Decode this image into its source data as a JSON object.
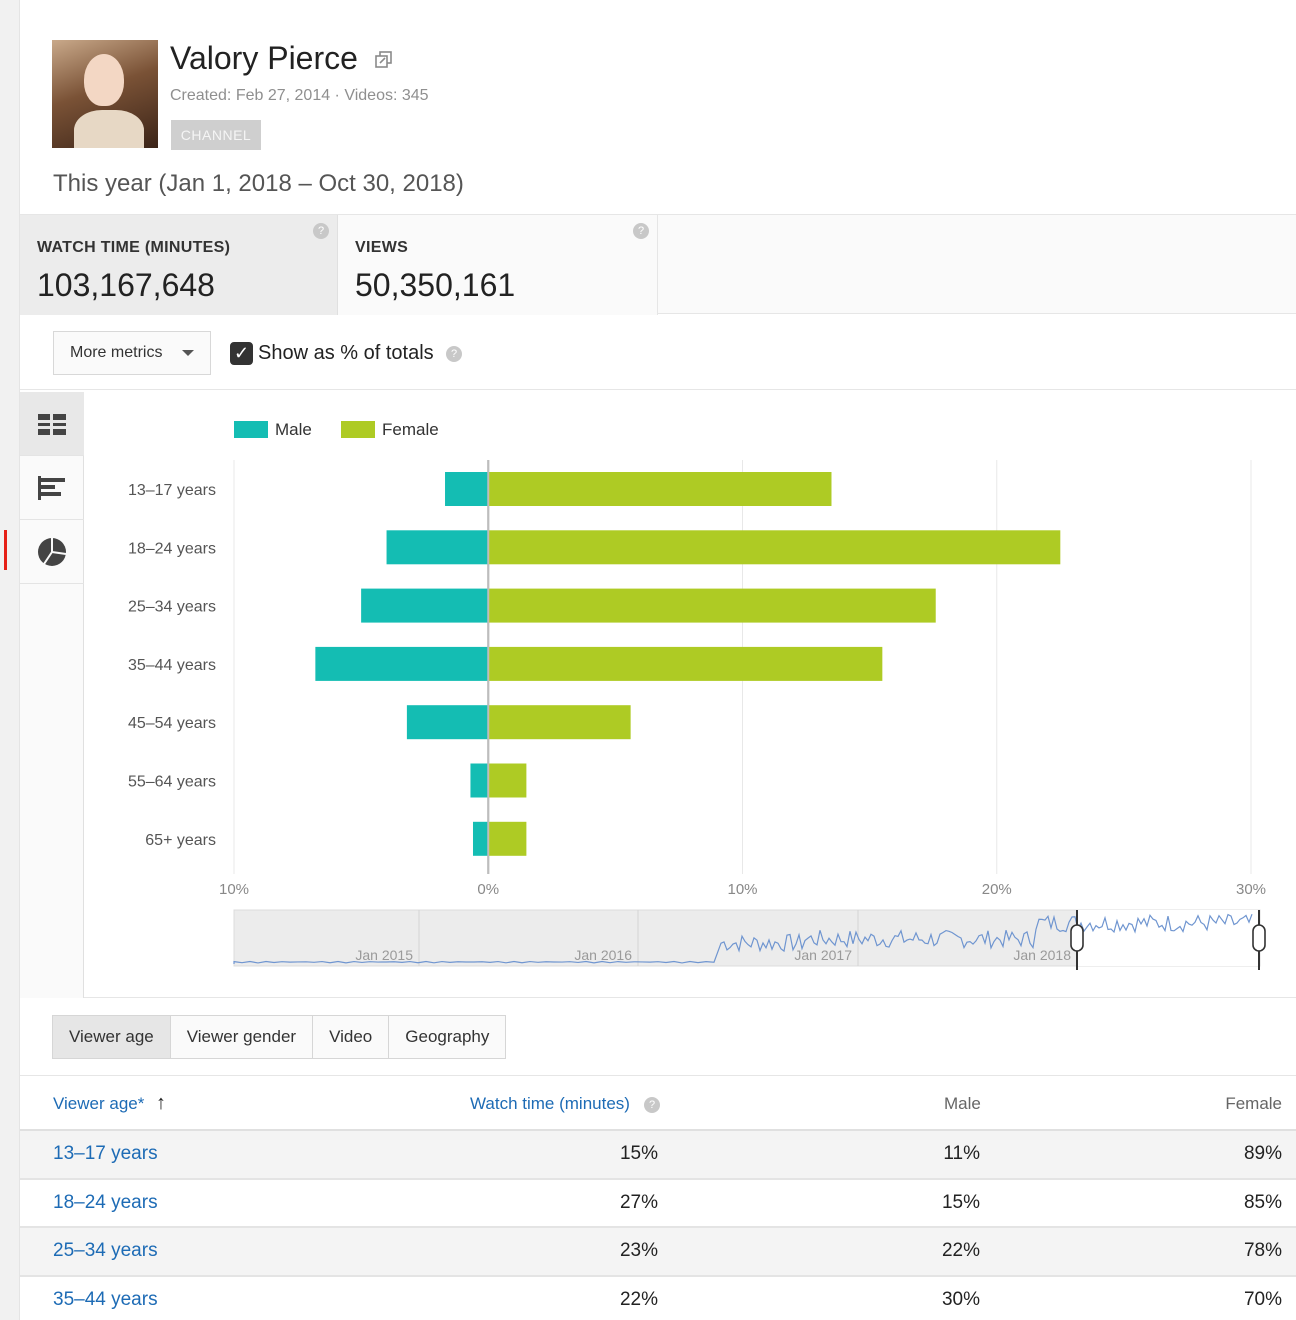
{
  "channel": {
    "name": "Valory Pierce",
    "meta": "Created: Feb 27, 2014  ·  Videos: 345",
    "badge": "CHANNEL"
  },
  "date_range": "This year (Jan 1, 2018 – Oct 30, 2018)",
  "metrics": [
    {
      "label": "WATCH TIME (MINUTES)",
      "value": "103,167,648"
    },
    {
      "label": "VIEWS",
      "value": "50,350,161"
    }
  ],
  "controls": {
    "more_metrics": "More metrics",
    "show_pct": "Show as % of totals"
  },
  "chart_tab_icons": [
    "grid-chart-icon",
    "bar-chart-icon",
    "pie-chart-icon"
  ],
  "chart_data": {
    "type": "bar",
    "orientation": "horizontal-diverging",
    "categories": [
      "13–17 years",
      "18–24 years",
      "25–34 years",
      "35–44 years",
      "45–54 years",
      "55–64 years",
      "65+ years"
    ],
    "series": [
      {
        "name": "Male",
        "color": "#14bdb3",
        "values": [
          1.7,
          4.0,
          5.0,
          6.8,
          3.2,
          0.7,
          0.6
        ]
      },
      {
        "name": "Female",
        "color": "#aecb24",
        "values": [
          13.5,
          22.5,
          17.6,
          15.5,
          5.6,
          1.5,
          1.5
        ]
      }
    ],
    "x_ticks": [
      "10%",
      "0%",
      "10%",
      "20%",
      "30%"
    ],
    "xlim": [
      -10,
      30
    ],
    "legend": "top-left",
    "grid": true,
    "timeline_labels": [
      "Jan 2015",
      "Jan 2016",
      "Jan 2017",
      "Jan 2018"
    ]
  },
  "table_tabs": [
    "Viewer age",
    "Viewer gender",
    "Video",
    "Geography"
  ],
  "table": {
    "headers": [
      "Viewer age*",
      "Watch time (minutes)",
      "Male",
      "Female"
    ],
    "rows": [
      [
        "13–17 years",
        "15%",
        "11%",
        "89%"
      ],
      [
        "18–24 years",
        "27%",
        "15%",
        "85%"
      ],
      [
        "25–34 years",
        "23%",
        "22%",
        "78%"
      ],
      [
        "35–44 years",
        "22%",
        "30%",
        "70%"
      ]
    ]
  }
}
